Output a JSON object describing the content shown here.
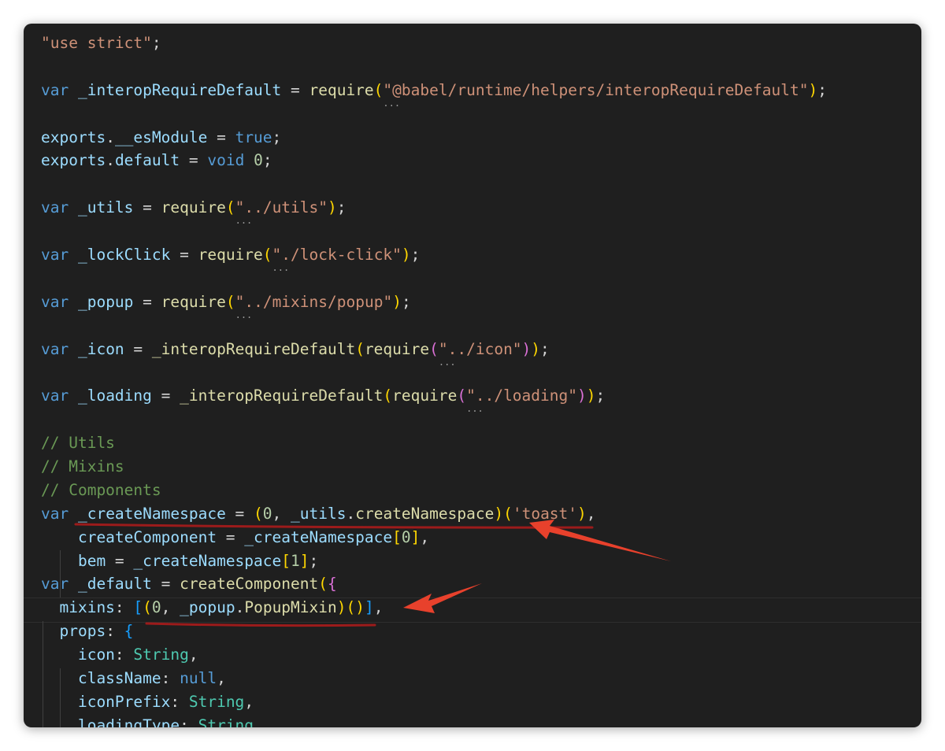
{
  "editor": {
    "language": "javascript",
    "lines": [
      [
        {
          "t": "\"use strict\"",
          "c": "str"
        },
        {
          "t": ";",
          "c": "pn"
        }
      ],
      [],
      [
        {
          "t": "var ",
          "c": "kw"
        },
        {
          "t": "_interopRequireDefault",
          "c": "var"
        },
        {
          "t": " = ",
          "c": "pn"
        },
        {
          "t": "require",
          "c": "fn"
        },
        {
          "t": "(",
          "c": "p1"
        },
        {
          "t": "\"",
          "c": "str dots"
        },
        {
          "t": "@babel/runtime/helpers/interopRequireDefault\"",
          "c": "str"
        },
        {
          "t": ")",
          "c": "p1"
        },
        {
          "t": ";",
          "c": "pn"
        }
      ],
      [],
      [
        {
          "t": "exports",
          "c": "var"
        },
        {
          "t": ".",
          "c": "pn"
        },
        {
          "t": "__esModule",
          "c": "var"
        },
        {
          "t": " = ",
          "c": "pn"
        },
        {
          "t": "true",
          "c": "kw"
        },
        {
          "t": ";",
          "c": "pn"
        }
      ],
      [
        {
          "t": "exports",
          "c": "var"
        },
        {
          "t": ".",
          "c": "pn"
        },
        {
          "t": "default",
          "c": "var"
        },
        {
          "t": " = ",
          "c": "pn"
        },
        {
          "t": "void ",
          "c": "kw"
        },
        {
          "t": "0",
          "c": "num"
        },
        {
          "t": ";",
          "c": "pn"
        }
      ],
      [],
      [
        {
          "t": "var ",
          "c": "kw"
        },
        {
          "t": "_utils",
          "c": "var"
        },
        {
          "t": " = ",
          "c": "pn"
        },
        {
          "t": "require",
          "c": "fn"
        },
        {
          "t": "(",
          "c": "p1"
        },
        {
          "t": "\"",
          "c": "str dots"
        },
        {
          "t": "../utils\"",
          "c": "str"
        },
        {
          "t": ")",
          "c": "p1"
        },
        {
          "t": ";",
          "c": "pn"
        }
      ],
      [],
      [
        {
          "t": "var ",
          "c": "kw"
        },
        {
          "t": "_lockClick",
          "c": "var"
        },
        {
          "t": " = ",
          "c": "pn"
        },
        {
          "t": "require",
          "c": "fn"
        },
        {
          "t": "(",
          "c": "p1"
        },
        {
          "t": "\"",
          "c": "str dots"
        },
        {
          "t": "./lock-click\"",
          "c": "str"
        },
        {
          "t": ")",
          "c": "p1"
        },
        {
          "t": ";",
          "c": "pn"
        }
      ],
      [],
      [
        {
          "t": "var ",
          "c": "kw"
        },
        {
          "t": "_popup",
          "c": "var"
        },
        {
          "t": " = ",
          "c": "pn"
        },
        {
          "t": "require",
          "c": "fn"
        },
        {
          "t": "(",
          "c": "p1"
        },
        {
          "t": "\"",
          "c": "str dots"
        },
        {
          "t": "../mixins/popup\"",
          "c": "str"
        },
        {
          "t": ")",
          "c": "p1"
        },
        {
          "t": ";",
          "c": "pn"
        }
      ],
      [],
      [
        {
          "t": "var ",
          "c": "kw"
        },
        {
          "t": "_icon",
          "c": "var"
        },
        {
          "t": " = ",
          "c": "pn"
        },
        {
          "t": "_interopRequireDefault",
          "c": "fn"
        },
        {
          "t": "(",
          "c": "p1"
        },
        {
          "t": "require",
          "c": "fn"
        },
        {
          "t": "(",
          "c": "p2"
        },
        {
          "t": "\"",
          "c": "str dots"
        },
        {
          "t": "../icon\"",
          "c": "str"
        },
        {
          "t": ")",
          "c": "p2"
        },
        {
          "t": ")",
          "c": "p1"
        },
        {
          "t": ";",
          "c": "pn"
        }
      ],
      [],
      [
        {
          "t": "var ",
          "c": "kw"
        },
        {
          "t": "_loading",
          "c": "var"
        },
        {
          "t": " = ",
          "c": "pn"
        },
        {
          "t": "_interopRequireDefault",
          "c": "fn"
        },
        {
          "t": "(",
          "c": "p1"
        },
        {
          "t": "require",
          "c": "fn"
        },
        {
          "t": "(",
          "c": "p2"
        },
        {
          "t": "\"",
          "c": "str dots"
        },
        {
          "t": "../loading\"",
          "c": "str"
        },
        {
          "t": ")",
          "c": "p2"
        },
        {
          "t": ")",
          "c": "p1"
        },
        {
          "t": ";",
          "c": "pn"
        }
      ],
      [],
      [
        {
          "t": "// Utils",
          "c": "cmt"
        }
      ],
      [
        {
          "t": "// Mixins",
          "c": "cmt"
        }
      ],
      [
        {
          "t": "// Components",
          "c": "cmt"
        }
      ],
      [
        {
          "t": "var ",
          "c": "kw"
        },
        {
          "t": "_createNamespace",
          "c": "var"
        },
        {
          "t": " = ",
          "c": "pn"
        },
        {
          "t": "(",
          "c": "p1"
        },
        {
          "t": "0",
          "c": "num"
        },
        {
          "t": ", ",
          "c": "pn"
        },
        {
          "t": "_utils",
          "c": "var"
        },
        {
          "t": ".",
          "c": "pn"
        },
        {
          "t": "createNamespace",
          "c": "fn"
        },
        {
          "t": ")",
          "c": "p1"
        },
        {
          "t": "(",
          "c": "p1"
        },
        {
          "t": "'toast'",
          "c": "str"
        },
        {
          "t": ")",
          "c": "p1"
        },
        {
          "t": ",",
          "c": "pn"
        }
      ],
      [
        {
          "t": "    createComponent",
          "c": "var"
        },
        {
          "t": " = ",
          "c": "pn"
        },
        {
          "t": "_createNamespace",
          "c": "var"
        },
        {
          "t": "[",
          "c": "p1"
        },
        {
          "t": "0",
          "c": "num"
        },
        {
          "t": "]",
          "c": "p1"
        },
        {
          "t": ",",
          "c": "pn"
        }
      ],
      [
        {
          "t": "    bem",
          "c": "var"
        },
        {
          "t": " = ",
          "c": "pn"
        },
        {
          "t": "_createNamespace",
          "c": "var"
        },
        {
          "t": "[",
          "c": "p1"
        },
        {
          "t": "1",
          "c": "num"
        },
        {
          "t": "]",
          "c": "p1"
        },
        {
          "t": ";",
          "c": "pn"
        }
      ],
      [
        {
          "t": "var ",
          "c": "kw"
        },
        {
          "t": "_default",
          "c": "var"
        },
        {
          "t": " = ",
          "c": "pn"
        },
        {
          "t": "createComponent",
          "c": "fn"
        },
        {
          "t": "(",
          "c": "p1"
        },
        {
          "t": "{",
          "c": "p2"
        }
      ],
      [
        {
          "t": "  mixins",
          "c": "var"
        },
        {
          "t": ": ",
          "c": "pn"
        },
        {
          "t": "[",
          "c": "p3"
        },
        {
          "t": "(",
          "c": "p1"
        },
        {
          "t": "0",
          "c": "num"
        },
        {
          "t": ", ",
          "c": "pn"
        },
        {
          "t": "_popup",
          "c": "var"
        },
        {
          "t": ".",
          "c": "pn"
        },
        {
          "t": "PopupMixin",
          "c": "fn"
        },
        {
          "t": ")",
          "c": "p1"
        },
        {
          "t": "(",
          "c": "p1"
        },
        {
          "t": ")",
          "c": "p1"
        },
        {
          "t": "]",
          "c": "p3"
        },
        {
          "t": ",",
          "c": "pn"
        }
      ],
      [
        {
          "t": "  props",
          "c": "var"
        },
        {
          "t": ": ",
          "c": "pn"
        },
        {
          "t": "{",
          "c": "p3"
        }
      ],
      [
        {
          "t": "    icon",
          "c": "var"
        },
        {
          "t": ": ",
          "c": "pn"
        },
        {
          "t": "String",
          "c": "cls"
        },
        {
          "t": ",",
          "c": "pn"
        }
      ],
      [
        {
          "t": "    className",
          "c": "var"
        },
        {
          "t": ": ",
          "c": "pn"
        },
        {
          "t": "null",
          "c": "kw"
        },
        {
          "t": ",",
          "c": "pn"
        }
      ],
      [
        {
          "t": "    iconPrefix",
          "c": "var"
        },
        {
          "t": ": ",
          "c": "pn"
        },
        {
          "t": "String",
          "c": "cls"
        },
        {
          "t": ",",
          "c": "pn"
        }
      ],
      [
        {
          "t": "    loadingType",
          "c": "var"
        },
        {
          "t": ": ",
          "c": "pn"
        },
        {
          "t": "String",
          "c": "cls"
        },
        {
          "t": ",",
          "c": "pn"
        }
      ]
    ]
  },
  "colors": {
    "background": "#1f1f1f",
    "annotation_red": "#e8412c",
    "underline_red": "#9c1b1b"
  }
}
